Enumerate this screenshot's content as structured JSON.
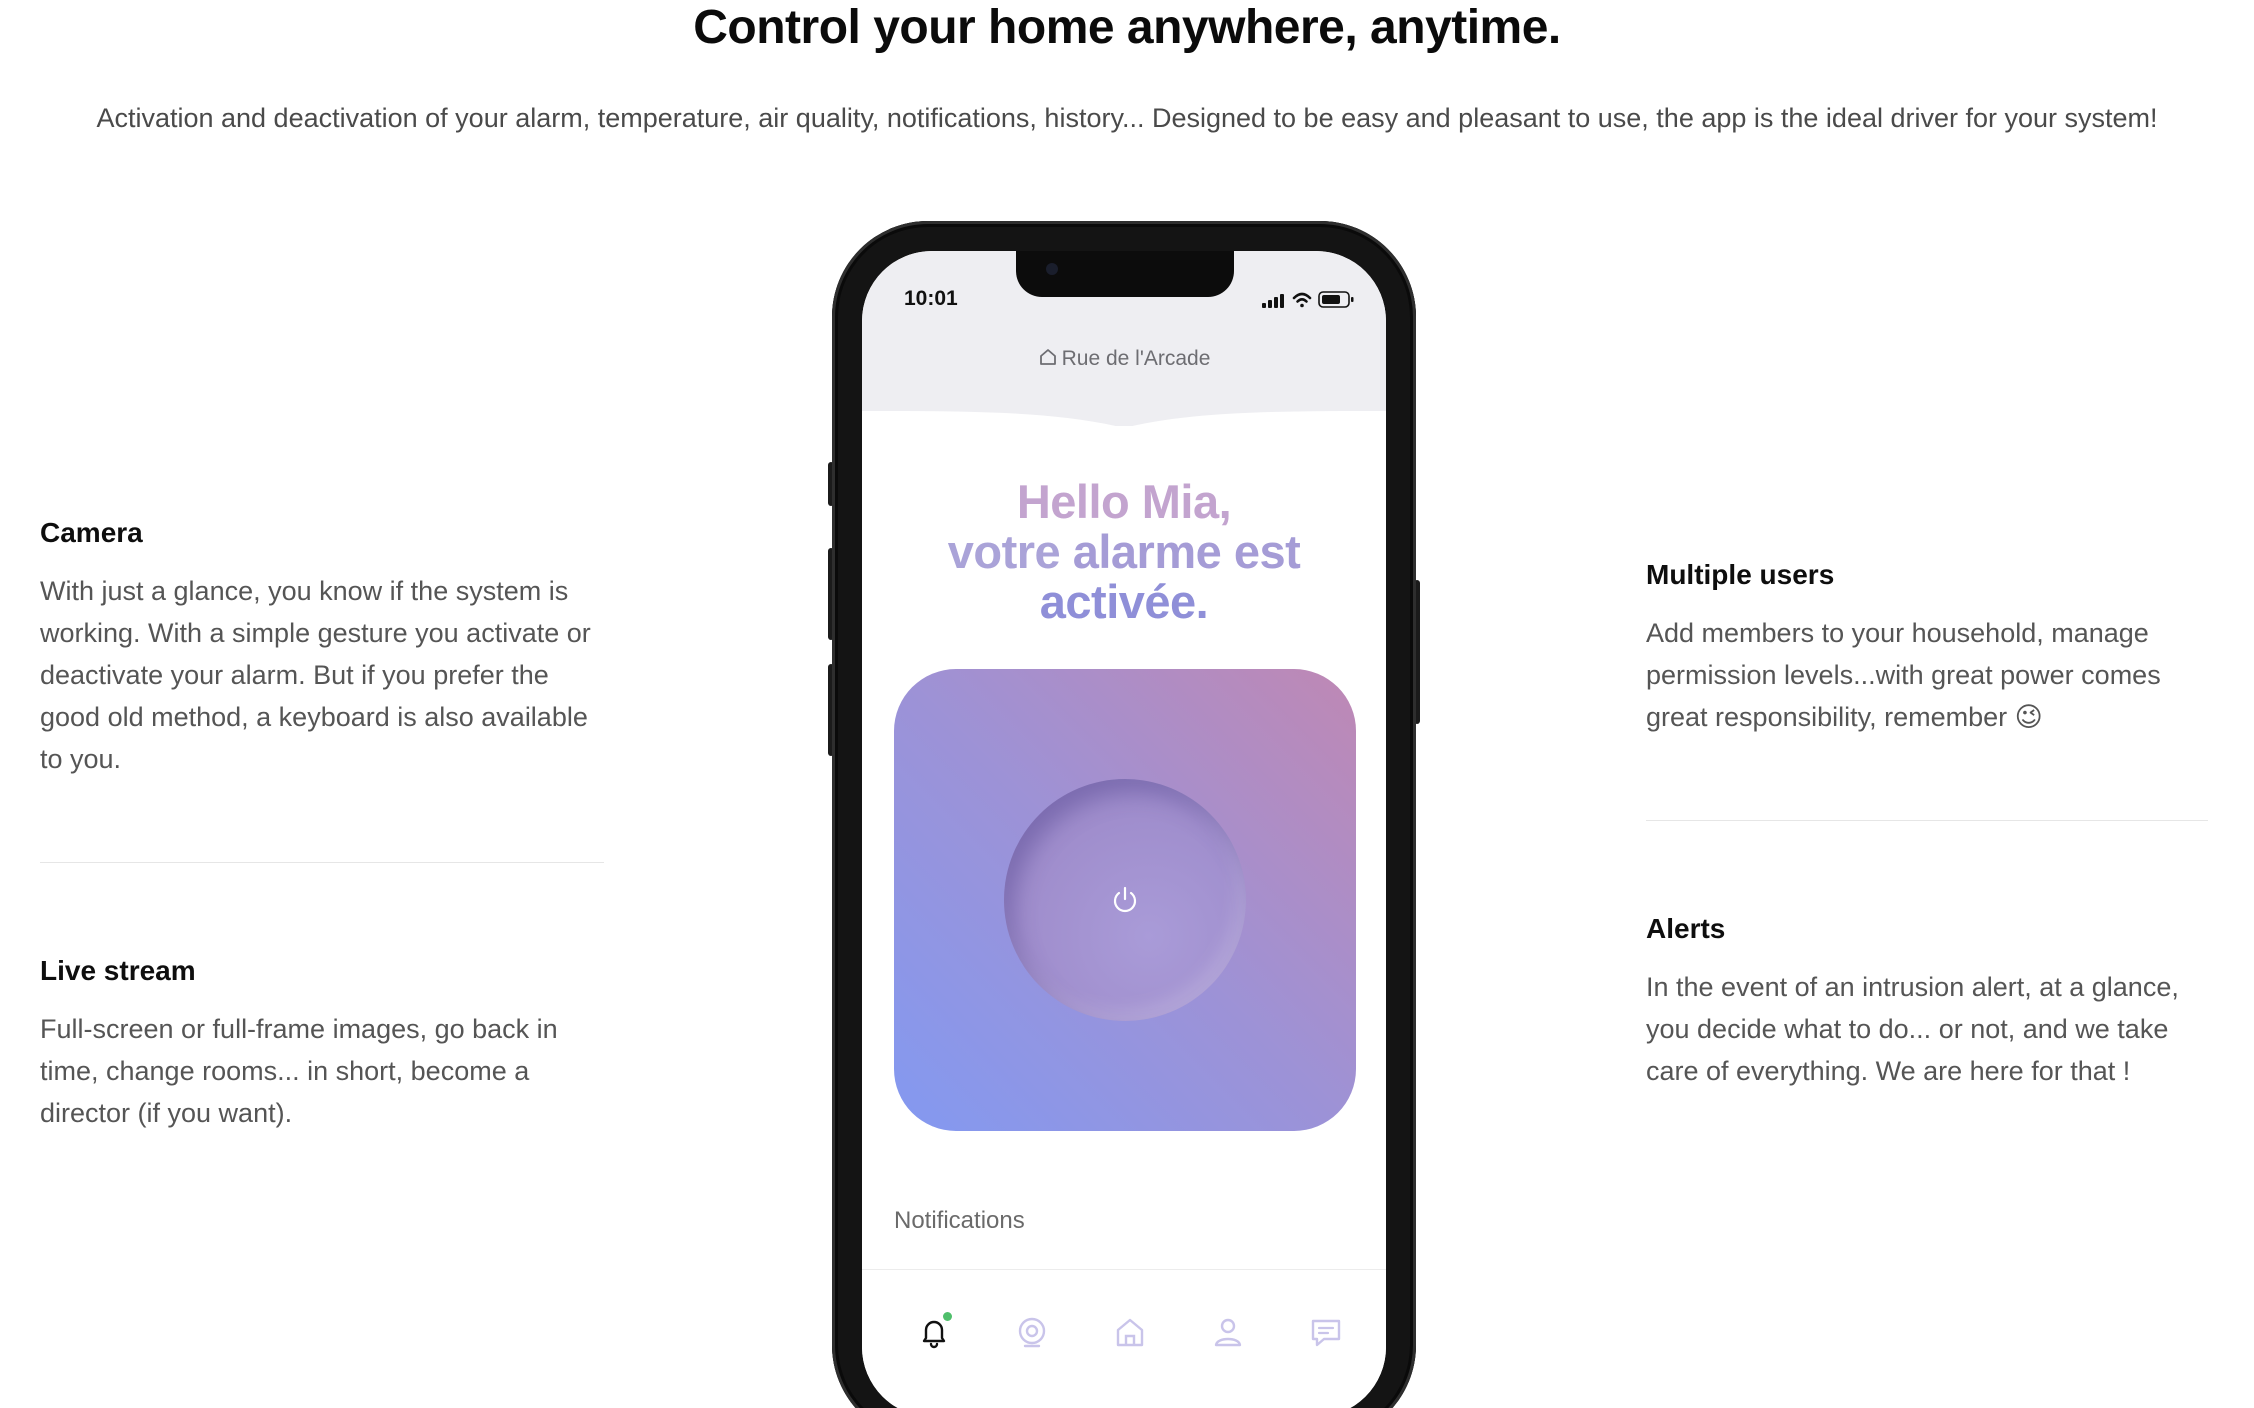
{
  "header": {
    "title": "Control your home anywhere, anytime.",
    "subtitle": "Activation and deactivation of your alarm, temperature, air quality, notifications, history... Designed to be easy and pleasant to use, the app is the ideal driver for your system!"
  },
  "features": {
    "camera": {
      "title": "Camera",
      "text": "With just a glance, you know if the system is working. With a simple gesture you activate or deactivate your alarm. But if you prefer the good old method, a keyboard is also available to you."
    },
    "live_stream": {
      "title": "Live stream",
      "text": "Full-screen or full-frame images, go back in time, change rooms... in short, become a director (if you want)."
    },
    "multiple_users": {
      "title": "Multiple users",
      "text": "Add members to your household, manage permission levels...with great power comes great responsibility, remember 😉"
    },
    "alerts": {
      "title": "Alerts",
      "text": "In the event of an intrusion alert, at a glance, you decide what to do... or not, and we take care of everything. We are here for that !"
    }
  },
  "phone": {
    "status_time": "10:01",
    "address": "Rue de l'Arcade",
    "greeting": {
      "line1": "Hello Mia,",
      "line2_a": "votre ",
      "line2_b": "alarme est",
      "line3": "activée."
    },
    "notifications_label": "Notifications",
    "tabs": [
      "bell-icon",
      "camera-icon",
      "home-icon",
      "user-icon",
      "chat-icon"
    ],
    "colors": {
      "card_gradient": [
        "#8399f1",
        "#9d92d6",
        "#bf88b4"
      ],
      "tab_inactive": "#c9c4ea",
      "notification_dot": "#4fbf6b"
    }
  }
}
